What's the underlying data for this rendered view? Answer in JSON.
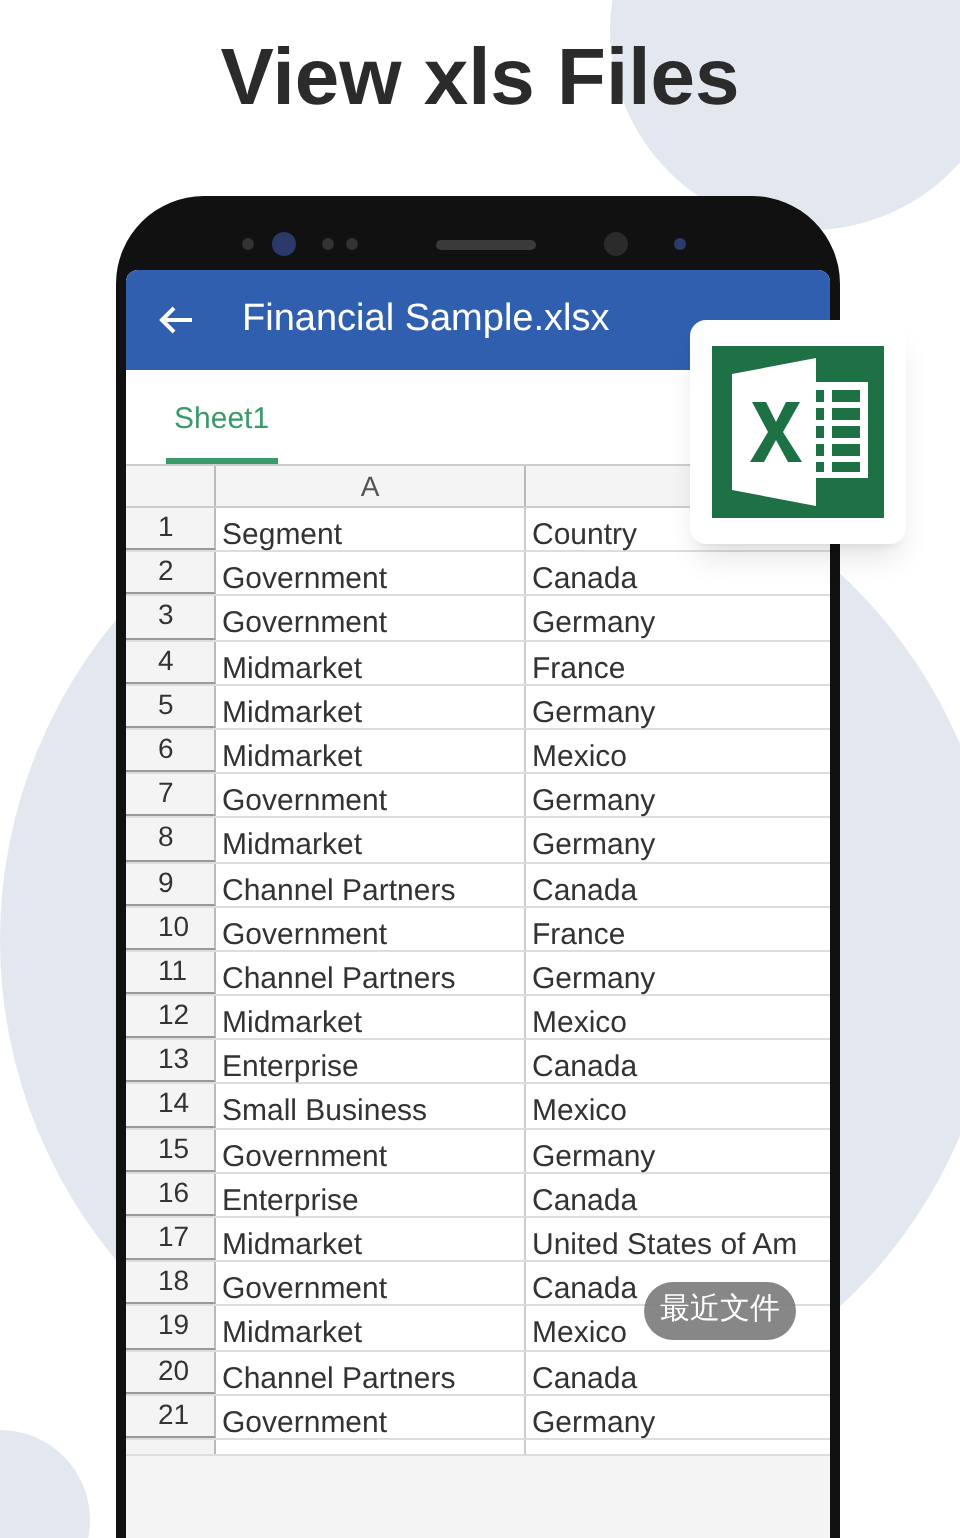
{
  "headline": "View xls Files",
  "app_bar": {
    "title": "Financial Sample.xlsx"
  },
  "sheet_tabs": [
    {
      "label": "Sheet1",
      "selected": true
    }
  ],
  "columns": [
    "A"
  ],
  "rows": [
    {
      "number": "1",
      "cells": [
        "Segment",
        "Country"
      ]
    },
    {
      "number": "2",
      "cells": [
        "Government",
        "Canada"
      ]
    },
    {
      "number": "3",
      "cells": [
        "Government",
        "Germany"
      ]
    },
    {
      "number": "4",
      "cells": [
        "Midmarket",
        "France"
      ]
    },
    {
      "number": "5",
      "cells": [
        "Midmarket",
        "Germany"
      ]
    },
    {
      "number": "6",
      "cells": [
        "Midmarket",
        "Mexico"
      ]
    },
    {
      "number": "7",
      "cells": [
        "Government",
        "Germany"
      ]
    },
    {
      "number": "8",
      "cells": [
        "Midmarket",
        "Germany"
      ]
    },
    {
      "number": "9",
      "cells": [
        "Channel Partners",
        "Canada"
      ]
    },
    {
      "number": "10",
      "cells": [
        "Government",
        "France"
      ]
    },
    {
      "number": "11",
      "cells": [
        "Channel Partners",
        "Germany"
      ]
    },
    {
      "number": "12",
      "cells": [
        "Midmarket",
        "Mexico"
      ]
    },
    {
      "number": "13",
      "cells": [
        "Enterprise",
        "Canada"
      ]
    },
    {
      "number": "14",
      "cells": [
        "Small Business",
        "Mexico"
      ]
    },
    {
      "number": "15",
      "cells": [
        "Government",
        "Germany"
      ]
    },
    {
      "number": "16",
      "cells": [
        "Enterprise",
        "Canada"
      ]
    },
    {
      "number": "17",
      "cells": [
        "Midmarket",
        "United States of Am"
      ]
    },
    {
      "number": "18",
      "cells": [
        "Government",
        "Canada"
      ]
    },
    {
      "number": "19",
      "cells": [
        "Midmarket",
        "Mexico"
      ]
    },
    {
      "number": "20",
      "cells": [
        "Channel Partners",
        "Canada"
      ]
    },
    {
      "number": "21",
      "cells": [
        "Government",
        "Germany"
      ]
    }
  ],
  "toast": "最近文件"
}
